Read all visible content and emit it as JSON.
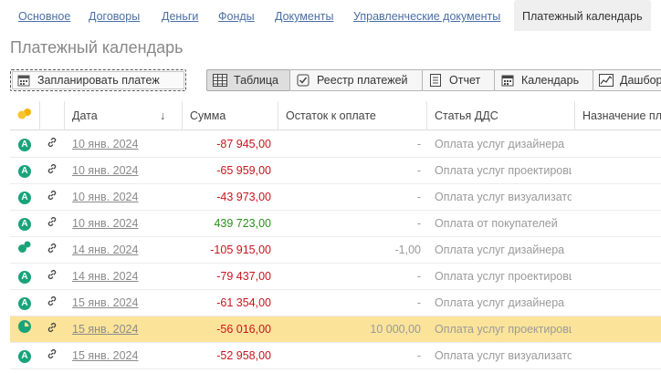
{
  "tabs": [
    {
      "label": "Основное"
    },
    {
      "label": "Договоры"
    },
    {
      "label": "Деньги"
    },
    {
      "label": "Фонды"
    },
    {
      "label": "Документы"
    },
    {
      "label": "Управленческие документы"
    },
    {
      "label": "Платежный календарь"
    }
  ],
  "page_title": "Платежный календарь",
  "toolbar": {
    "plan_label": "Запланировать платеж",
    "table_label": "Таблица",
    "registry_label": "Реестр платежей",
    "report_label": "Отчет",
    "calendar_label": "Календарь",
    "dashboard_label": "Дашборд"
  },
  "grid": {
    "columns": [
      "Дата",
      "Сумма",
      "Остаток к оплате",
      "Статья ДДС",
      "Назначение платежа"
    ],
    "sort_indicator": "↓",
    "rows": [
      {
        "status": "A",
        "date": "10 янв. 2024",
        "sum": "-87 945,00",
        "sign": "neg",
        "rest": "-",
        "article": "Оплата услуг дизайнера",
        "purpose": ""
      },
      {
        "status": "A",
        "date": "10 янв. 2024",
        "sum": "-65 959,00",
        "sign": "neg",
        "rest": "-",
        "article": "Оплата услуг проектировщика",
        "purpose": ""
      },
      {
        "status": "A",
        "date": "10 янв. 2024",
        "sum": "-43 973,00",
        "sign": "neg",
        "rest": "-",
        "article": "Оплата услуг визуализатора",
        "purpose": ""
      },
      {
        "status": "A",
        "date": "10 янв. 2024",
        "sum": "439 723,00",
        "sign": "pos",
        "rest": "-",
        "article": "Оплата от покупателей",
        "purpose": ""
      },
      {
        "status": "dots",
        "date": "14 янв. 2024",
        "sum": "-105 915,00",
        "sign": "neg",
        "rest": "-1,00",
        "article": "Оплата услуг дизайнера",
        "purpose": ""
      },
      {
        "status": "A",
        "date": "14 янв. 2024",
        "sum": "-79 437,00",
        "sign": "neg",
        "rest": "-",
        "article": "Оплата услуг проектировщика",
        "purpose": ""
      },
      {
        "status": "A",
        "date": "15 янв. 2024",
        "sum": "-61 354,00",
        "sign": "neg",
        "rest": "-",
        "article": "Оплата услуг дизайнера",
        "purpose": ""
      },
      {
        "status": "partial",
        "date": "15 янв. 2024",
        "sum": "-56 016,00",
        "sign": "neg",
        "rest": "10 000,00",
        "article": "Оплата услуг проектировщика",
        "purpose": "",
        "selected": true
      },
      {
        "status": "A",
        "date": "15 янв. 2024",
        "sum": "-52 958,00",
        "sign": "neg",
        "rest": "-",
        "article": "Оплата услуг визуализатора",
        "purpose": ""
      }
    ]
  },
  "colors": {
    "negative": "#c8141e",
    "positive": "#2b8f1d",
    "status": "#1aa37a",
    "selected_row": "#fbe49a"
  },
  "icons": [
    "status-group-icon",
    "link-icon",
    "table-icon",
    "checklist-icon",
    "report-icon",
    "calendar-icon",
    "dashboard-icon"
  ]
}
